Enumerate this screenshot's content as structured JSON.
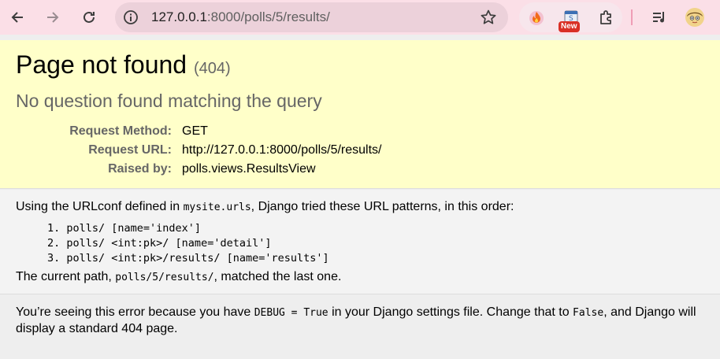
{
  "browser": {
    "url_host": "127.0.0.1",
    "url_rest": ":8000/polls/5/results/",
    "new_badge": "New"
  },
  "summary": {
    "title": "Page not found",
    "status_code": "(404)",
    "subtitle": "No question found matching the query",
    "meta": [
      {
        "key": "Request Method:",
        "value": "GET"
      },
      {
        "key": "Request URL:",
        "value": "http://127.0.0.1:8000/polls/5/results/"
      },
      {
        "key": "Raised by:",
        "value": "polls.views.ResultsView"
      }
    ]
  },
  "info": {
    "intro_prefix": "Using the URLconf defined in ",
    "intro_module": "mysite.urls",
    "intro_suffix": ", Django tried these URL patterns, in this order:",
    "patterns": [
      "1. polls/ [name='index']",
      "2. polls/ <int:pk>/ [name='detail']",
      "3. polls/ <int:pk>/results/ [name='results']"
    ],
    "current_prefix": "The current path, ",
    "current_path": "polls/5/results/",
    "current_suffix": ", matched the last one."
  },
  "explanation": {
    "part1": "You’re seeing this error because you have ",
    "code1": "DEBUG = True",
    "part2": " in your Django settings file. Change that to ",
    "code2": "False",
    "part3": ", and Django will display a standard 404 page."
  },
  "colors": {
    "toolbar_bg": "#fbdfe7",
    "summary_bg": "#ffffc9",
    "info_bg": "#f3f3f3",
    "explanation_bg": "#eeeeee"
  }
}
